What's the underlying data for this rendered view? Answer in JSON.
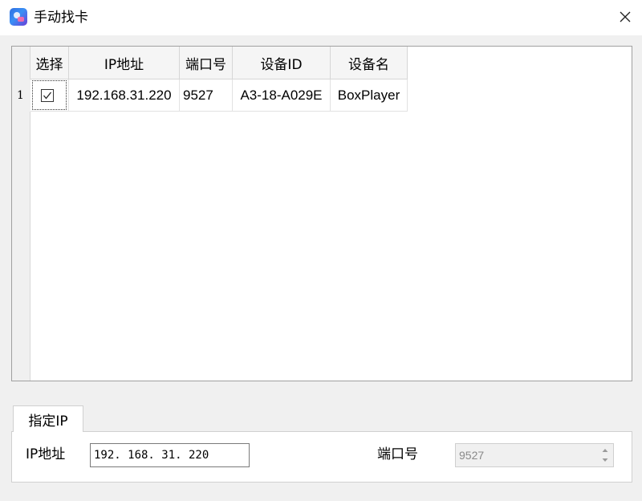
{
  "window": {
    "title": "手动找卡",
    "icon": "app-logo-icon",
    "close_icon": "close-icon"
  },
  "grid": {
    "columns": [
      "选择",
      "IP地址",
      "端口号",
      "设备ID",
      "设备名"
    ],
    "rows": [
      {
        "row_number": "1",
        "selected": true,
        "ip": "192.168.31.220",
        "port": "9527",
        "device_id": "A3-18-A029E",
        "device_name": "BoxPlayer"
      }
    ]
  },
  "specify_ip": {
    "tab_label": "指定IP",
    "ip_label": "IP地址",
    "ip_value": "192. 168. 31. 220",
    "port_label": "端口号",
    "port_value": "9527"
  }
}
